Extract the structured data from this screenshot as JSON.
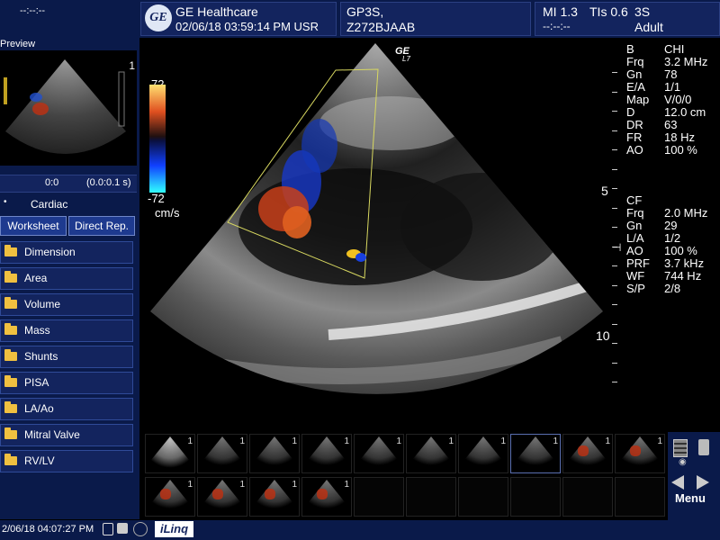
{
  "header": {
    "cine_time": "--:--:--",
    "brand": "GE Healthcare",
    "datetime_user": "02/06/18 03:59:14 PM USR",
    "patient_line1": "GP3S,",
    "patient_line2": "Z272BJAAB",
    "mi": "MI 1.3",
    "tis": "TIs 0.6",
    "probe": "3S",
    "preset": "Adult",
    "line2_right": "--:--:--"
  },
  "left_panel": {
    "preview_label": "Preview",
    "preview_index": "1",
    "cine_start": "0:0",
    "cine_range": "(0.0:0.1 s)",
    "category": "Cardiac",
    "tabs": [
      "Worksheet",
      "Direct Rep."
    ],
    "menu": [
      "Dimension",
      "Area",
      "Volume",
      "Mass",
      "Shunts",
      "PISA",
      "LA/Ao",
      "Mitral Valve",
      "RV/LV"
    ]
  },
  "color_scale": {
    "top": "72",
    "bottom": "-72",
    "unit": "cm/s"
  },
  "image": {
    "ge_mark": "GE",
    "probe_mark": "L7",
    "depth_5": "5",
    "depth_10": "10"
  },
  "b_params": [
    [
      "B",
      "CHI"
    ],
    [
      "Frq",
      "3.2 MHz"
    ],
    [
      "Gn",
      "78"
    ],
    [
      "E/A",
      "1/1"
    ],
    [
      "Map",
      "V/0/0"
    ],
    [
      "D",
      "12.0 cm"
    ],
    [
      "DR",
      "63"
    ],
    [
      "FR",
      "18 Hz"
    ],
    [
      "AO",
      "100 %"
    ]
  ],
  "cf_params": [
    [
      "CF",
      ""
    ],
    [
      "Frq",
      "2.0 MHz"
    ],
    [
      "Gn",
      "29"
    ],
    [
      "L/A",
      "1/2"
    ],
    [
      "AO",
      "100 %"
    ],
    [
      "PRF",
      "3.7 kHz"
    ],
    [
      "WF",
      "744 Hz"
    ],
    [
      "S/P",
      "2/8"
    ]
  ],
  "thumbnails": {
    "row1": [
      "1",
      "1",
      "1",
      "1",
      "1",
      "1",
      "1",
      "1",
      "1",
      "1"
    ],
    "row2": [
      "1",
      "1",
      "1",
      "1"
    ],
    "selected_index": 7
  },
  "right_controls": {
    "menu_label": "Menu"
  },
  "status": {
    "datetime": "2/06/18 04:07:27 PM",
    "brand": "iLinq"
  },
  "colors": {
    "panel": "#0a1a4a",
    "box": "#13245e",
    "accent": "#1e3a8f"
  }
}
